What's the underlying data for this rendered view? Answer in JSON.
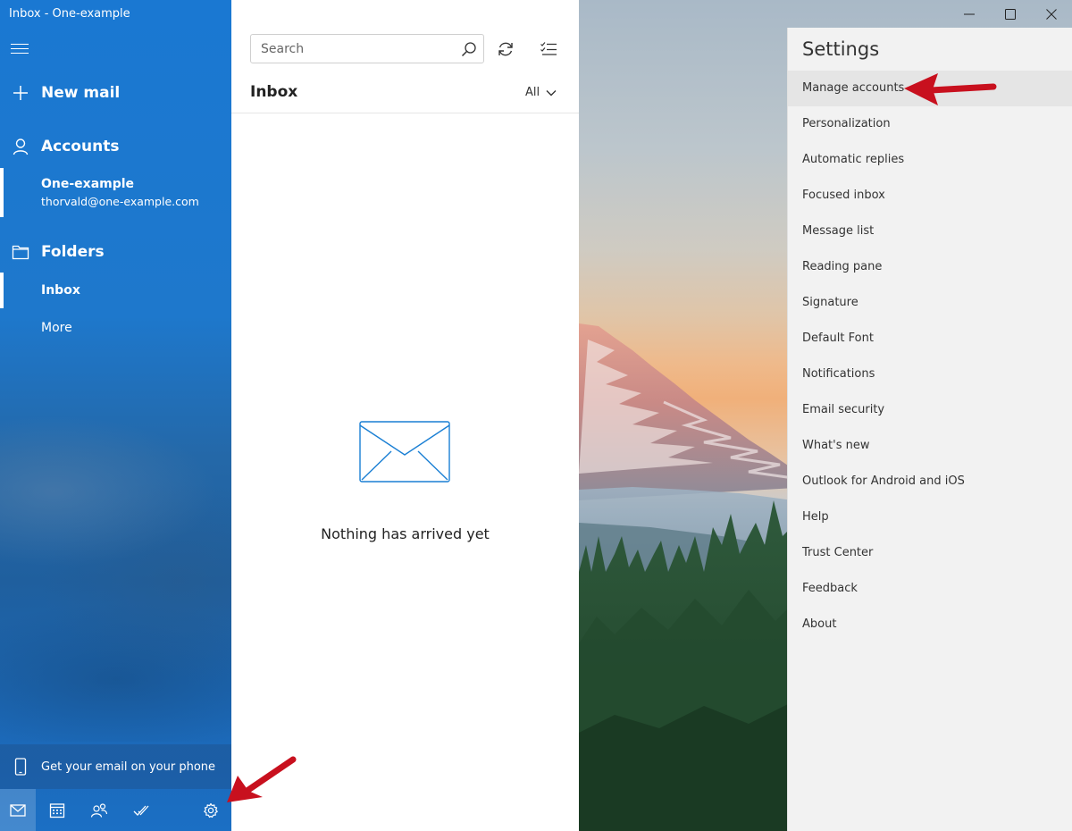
{
  "window": {
    "title": "Inbox - One-example"
  },
  "nav": {
    "new_mail": "New mail",
    "accounts": "Accounts",
    "account": {
      "name": "One-example",
      "email": "thorvald@one-example.com"
    },
    "folders": "Folders",
    "folder_items": [
      "Inbox",
      "More"
    ],
    "phone_promo": "Get your email on your phone"
  },
  "list": {
    "search_placeholder": "Search",
    "title": "Inbox",
    "filter": "All",
    "empty_message": "Nothing has arrived yet"
  },
  "settings": {
    "title": "Settings",
    "items": [
      "Manage accounts",
      "Personalization",
      "Automatic replies",
      "Focused inbox",
      "Message list",
      "Reading pane",
      "Signature",
      "Default Font",
      "Notifications",
      "Email security",
      "What's new",
      "Outlook for Android and iOS",
      "Help",
      "Trust Center",
      "Feedback",
      "About"
    ]
  },
  "colors": {
    "nav_blue": "#1a78d2",
    "accent": "#0078d4",
    "annotation_arrow": "#c8101e",
    "settings_bg": "#f2f2f2"
  }
}
